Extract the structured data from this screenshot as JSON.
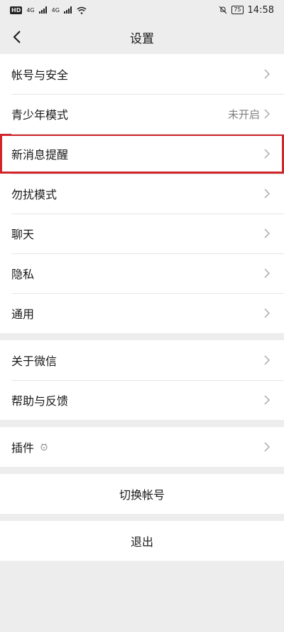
{
  "status_bar": {
    "left_badge": "HD",
    "net1": "4G",
    "net2": "4G",
    "battery": "75",
    "time": "14:58"
  },
  "nav": {
    "title": "设置",
    "back_icon": "back-icon"
  },
  "groups": [
    {
      "items": [
        {
          "label": "帐号与安全"
        },
        {
          "label": "青少年模式",
          "value": "未开启"
        },
        {
          "label": "新消息提醒",
          "highlighted": true
        },
        {
          "label": "勿扰模式"
        },
        {
          "label": "聊天"
        },
        {
          "label": "隐私"
        },
        {
          "label": "通用"
        }
      ]
    },
    {
      "items": [
        {
          "label": "关于微信"
        },
        {
          "label": "帮助与反馈"
        }
      ]
    },
    {
      "items": [
        {
          "label": "插件",
          "icon": "plugin-icon"
        }
      ]
    }
  ],
  "actions": {
    "switch_account": "切换帐号",
    "logout": "退出"
  },
  "colors": {
    "background": "#ededed",
    "highlight": "#d0252a"
  }
}
